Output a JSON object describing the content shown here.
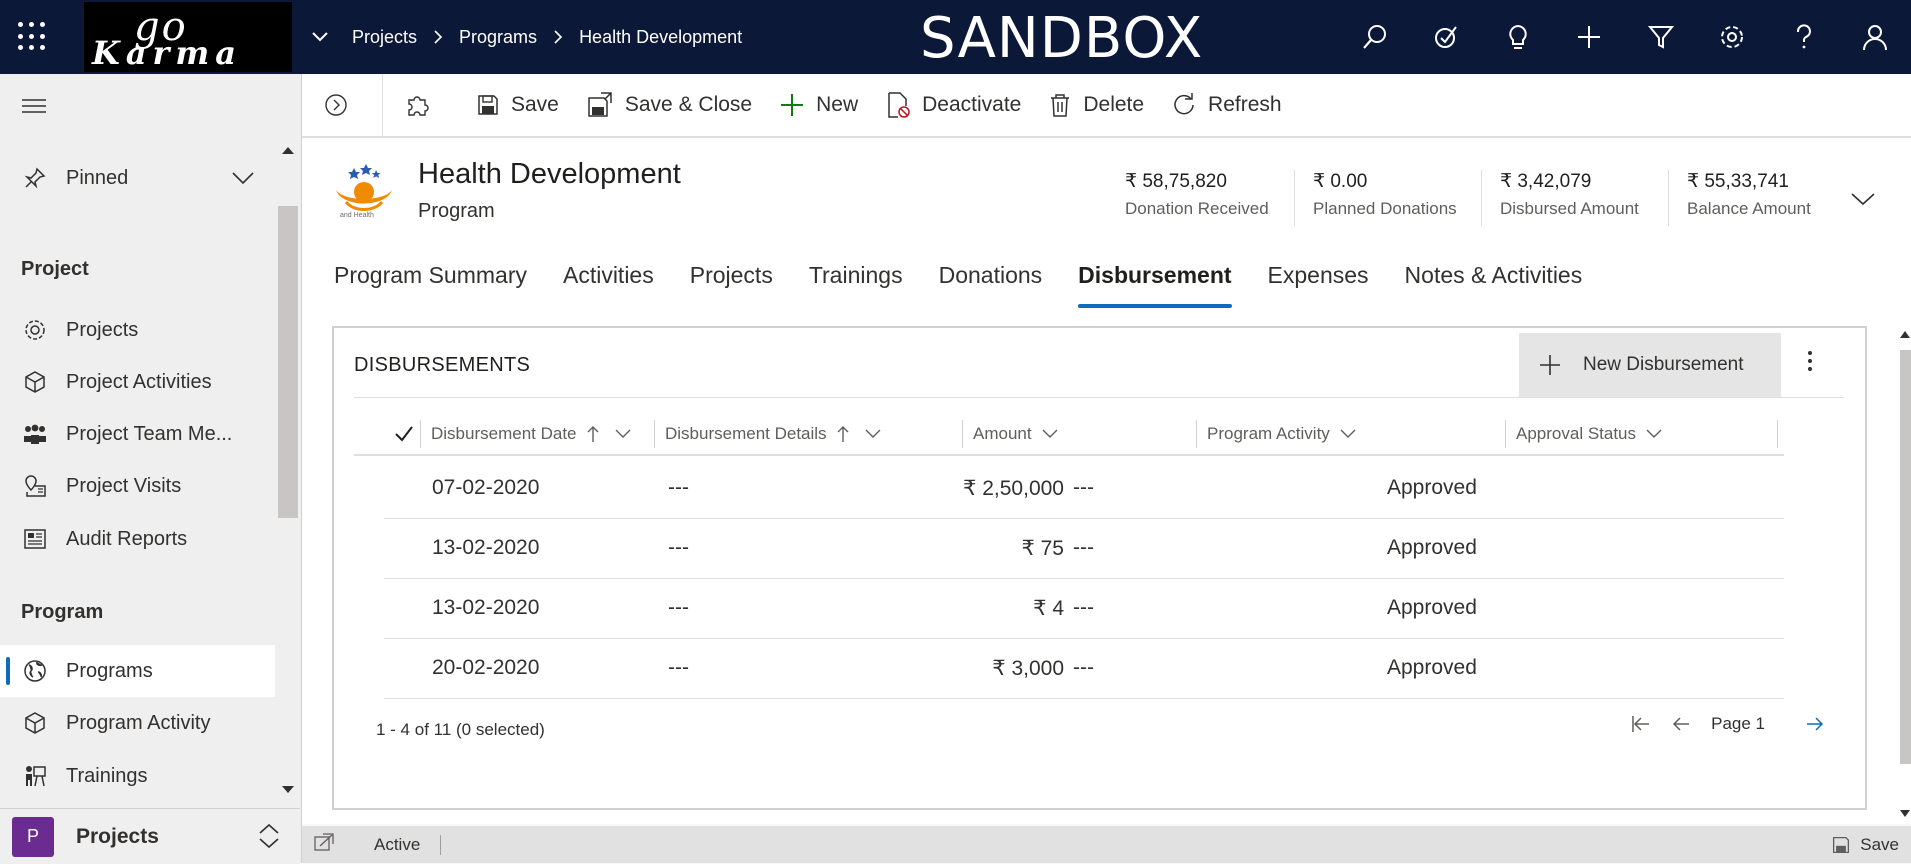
{
  "topbar": {
    "logo_text_1": "go",
    "logo_text_2": "Karma",
    "breadcrumbs": [
      "Projects",
      "Programs",
      "Health Development"
    ],
    "environment": "SANDBOX",
    "icons": [
      "search-icon",
      "task-icon",
      "lightbulb-icon",
      "plus-icon",
      "filter-icon",
      "settings-icon",
      "help-icon",
      "user-icon"
    ]
  },
  "sidebar": {
    "pinned_label": "Pinned",
    "section_project": "Project",
    "project_items": [
      {
        "label": "Projects",
        "icon": "gear-icon"
      },
      {
        "label": "Project Activities",
        "icon": "cube-icon"
      },
      {
        "label": "Project Team Me...",
        "icon": "team-icon"
      },
      {
        "label": "Project Visits",
        "icon": "map-pin-icon"
      },
      {
        "label": "Audit Reports",
        "icon": "report-icon"
      }
    ],
    "section_program": "Program",
    "program_items": [
      {
        "label": "Programs",
        "icon": "globe-icon"
      },
      {
        "label": "Program Activity",
        "icon": "cube-icon"
      },
      {
        "label": "Trainings",
        "icon": "training-icon"
      }
    ],
    "area": {
      "badge": "P",
      "label": "Projects"
    }
  },
  "commands": {
    "save": "Save",
    "save_close": "Save & Close",
    "new": "New",
    "deactivate": "Deactivate",
    "delete": "Delete",
    "refresh": "Refresh"
  },
  "record": {
    "title": "Health Development",
    "type": "Program",
    "logo_caption": "and Health",
    "metrics": [
      {
        "value": "₹ 58,75,820",
        "label": "Donation Received"
      },
      {
        "value": "₹ 0.00",
        "label": "Planned Donations"
      },
      {
        "value": "₹ 3,42,079",
        "label": "Disbursed Amount"
      },
      {
        "value": "₹ 55,33,741",
        "label": "Balance Amount"
      }
    ]
  },
  "tabs": [
    "Program Summary",
    "Activities",
    "Projects",
    "Trainings",
    "Donations",
    "Disbursement",
    "Expenses",
    "Notes & Activities"
  ],
  "selected_tab": "Disbursement",
  "grid": {
    "title": "DISBURSEMENTS",
    "new_button": "New Disbursement",
    "columns": [
      "Disbursement Date",
      "Disbursement Details",
      "Amount",
      "Program Activity",
      "Approval Status"
    ],
    "rows": [
      [
        "07-02-2020",
        "---",
        "₹ 2,50,000",
        "---",
        "Approved"
      ],
      [
        "13-02-2020",
        "---",
        "₹ 75",
        "---",
        "Approved"
      ],
      [
        "13-02-2020",
        "---",
        "₹ 4",
        "---",
        "Approved"
      ],
      [
        "20-02-2020",
        "---",
        "₹ 3,000",
        "---",
        "Approved"
      ]
    ],
    "count_text": "1 - 4 of 11 (0 selected)",
    "page_text": "Page 1"
  },
  "status_bar": {
    "status": "Active",
    "save": "Save"
  },
  "colors": {
    "topbar": "#0b1838",
    "accent": "#0f6cbd",
    "area_badge": "#6b2c91",
    "new_green": "#107c10"
  }
}
